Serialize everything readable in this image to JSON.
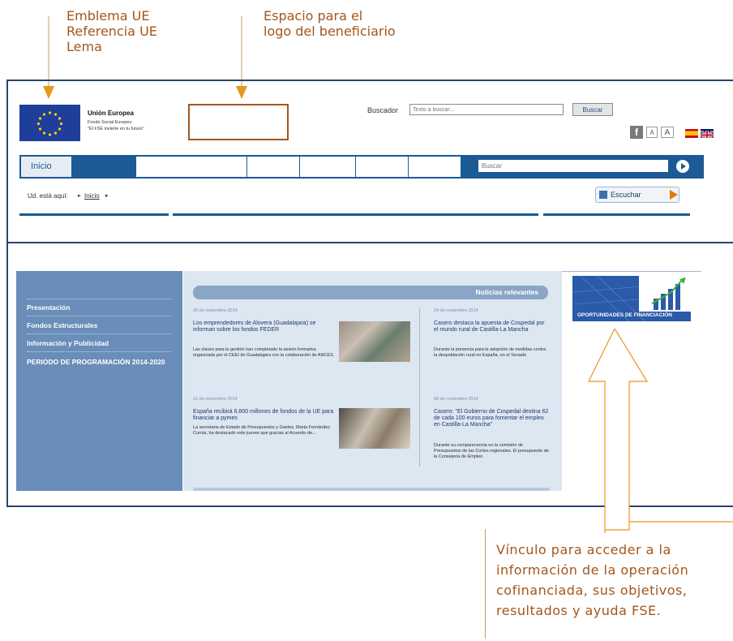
{
  "annotations": {
    "emblem": [
      "Emblema UE",
      "Referencia UE",
      "Lema"
    ],
    "logo": [
      "Espacio para el",
      "logo del beneficiario"
    ],
    "link": [
      "Vínculo para acceder a la",
      "información de la operación",
      "cofinanciada, sus objetivos,",
      "resultados y ayuda FSE."
    ]
  },
  "header": {
    "eu_title": "Unión Europea",
    "eu_fund": "Fondo Social Europeo",
    "eu_motto": "\"El FSE invierte en tu futuro\"",
    "search_label": "Buscador",
    "search_placeholder": "Texto a buscar...",
    "search_button": "Buscar",
    "font_small": "A",
    "font_large": "A"
  },
  "nav": {
    "home": "Inicio",
    "search_label": "Buscar"
  },
  "breadcrumb": {
    "prefix": "Ud. está aquí:",
    "home": "Inicio",
    "listen": "Escuchar"
  },
  "sidebar": {
    "items": [
      {
        "label": "Presentación"
      },
      {
        "label": "Fondos Estructurales"
      },
      {
        "label": "Información y Publicidad"
      },
      {
        "label": "PERIODO DE PROGRAMACIÓN 2014-2020"
      }
    ]
  },
  "news": {
    "header": "Noticias relevantes",
    "items": [
      {
        "date": "26 de noviembre 2014",
        "title": "Los emprendedores de Alovera (Guadalajara) se informan sobre los fondos FEDER",
        "body": "Las claves para la gestión han completado la sesión formativa organizada por el CEEI de Guadalajara con la colaboración de ANCES."
      },
      {
        "date": "24 de noviembre 2014",
        "title": "Casero destaca la apuesta de Cospedal por el mundo rural de Castilla-La Mancha",
        "body": "Durante la ponencia para la adopción de medidas contra la despoblación rural en España, en el Senado"
      },
      {
        "date": "13 de noviembre 2014",
        "title": "España recibirá 6.800 millones de fondos de la UE para financiar a pymes",
        "body": "La secretaria de Estado de Presupuestos y Gastos, Marta Fernández Currás, ha destacado este jueves que gracias al Acuerdo de..."
      },
      {
        "date": "08 de noviembre 2014",
        "title": "Casero: \"El Gobierno de Cospedal destina 62 de cada 100 euros para fomentar el empleo en Castilla-La Mancha\"",
        "body": "Durante su comparecencia en la comisión de Presupuestos de las Cortes regionales. El presupuesto de la Consejería de Empleo"
      }
    ]
  },
  "banner": {
    "text": "OPORTUNIDADES DE FINANCIACIÓN"
  },
  "colors": {
    "annotation": "#a4561b",
    "frame": "#27456d",
    "nav": "#1b5a95",
    "sidebar": "#6a8db9",
    "news_bg": "#dde7f2"
  }
}
